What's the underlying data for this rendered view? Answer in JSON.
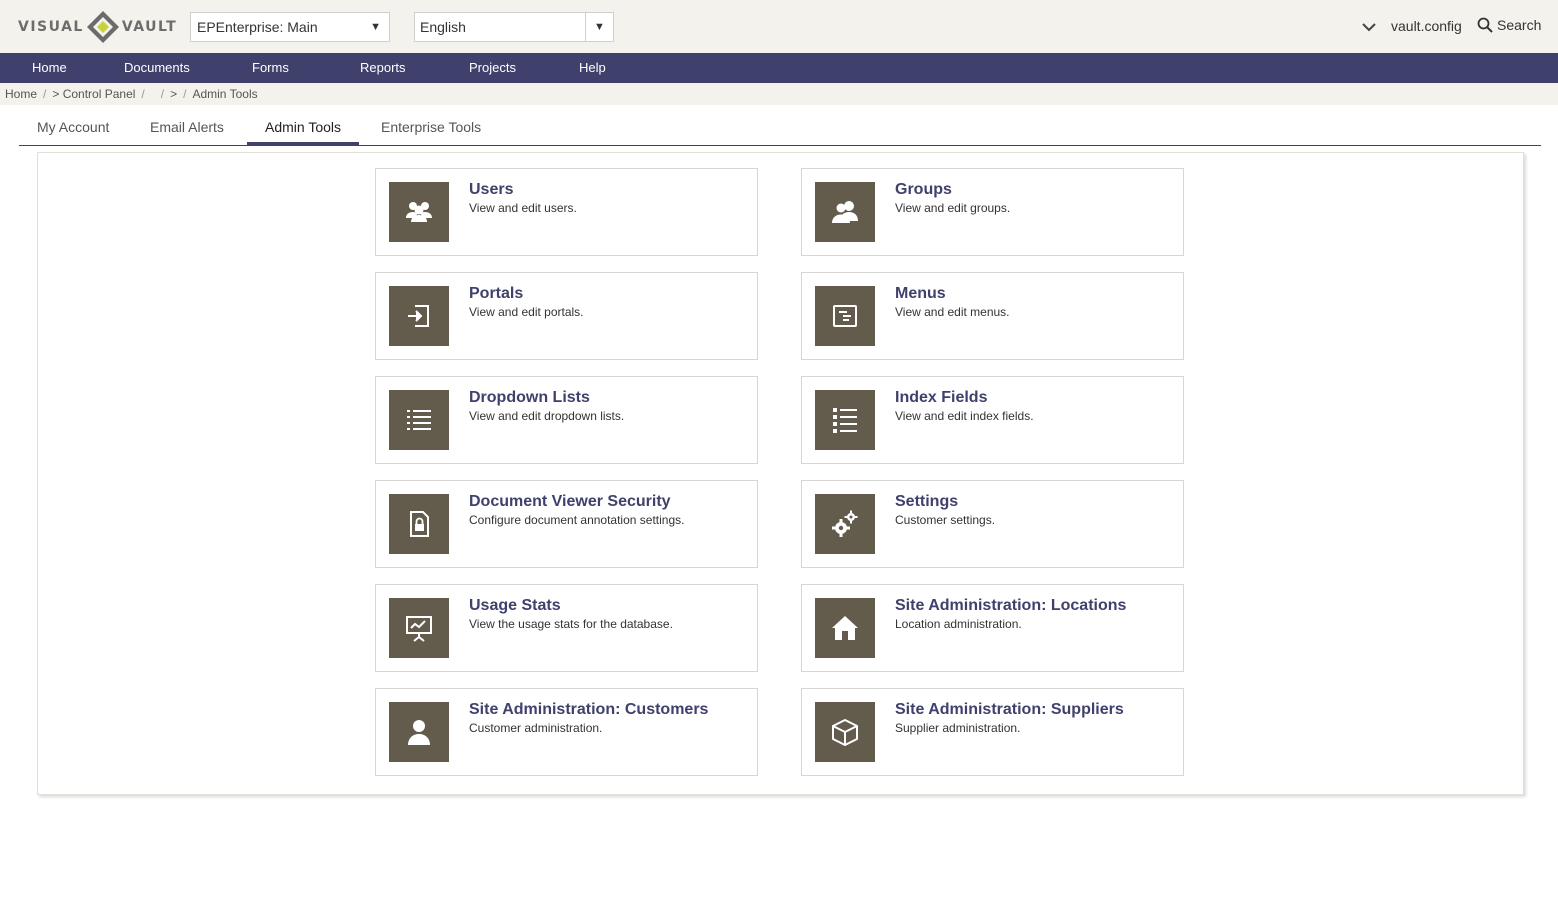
{
  "header": {
    "logo_left": "VISUAL",
    "logo_right": "VAULT",
    "database_select": "EPEnterprise: Main",
    "language_select": "English",
    "user": "vault.config",
    "search_label": "Search"
  },
  "nav": {
    "items": [
      "Home",
      "Documents",
      "Forms",
      "Reports",
      "Projects",
      "Help"
    ]
  },
  "breadcrumb": {
    "home": "Home",
    "control_panel": "> Control Panel",
    "mid": ">",
    "current": "Admin Tools"
  },
  "tabs": [
    "My Account",
    "Email Alerts",
    "Admin Tools",
    "Enterprise Tools"
  ],
  "active_tab": "Admin Tools",
  "cards": [
    {
      "title": "Users",
      "desc": "View and edit users.",
      "icon": "users-icon"
    },
    {
      "title": "Groups",
      "desc": "View and edit groups.",
      "icon": "groups-icon"
    },
    {
      "title": "Portals",
      "desc": "View and edit portals.",
      "icon": "portal-enter-icon"
    },
    {
      "title": "Menus",
      "desc": "View and edit menus.",
      "icon": "menu-icon"
    },
    {
      "title": "Dropdown Lists",
      "desc": "View and edit dropdown lists.",
      "icon": "list-icon"
    },
    {
      "title": "Index Fields",
      "desc": "View and edit index fields.",
      "icon": "index-list-icon"
    },
    {
      "title": "Document Viewer Security",
      "desc": "Configure document annotation settings.",
      "icon": "locked-document-icon"
    },
    {
      "title": "Settings",
      "desc": "Customer settings.",
      "icon": "gears-icon"
    },
    {
      "title": "Usage Stats",
      "desc": "View the usage stats for the database.",
      "icon": "presentation-chart-icon"
    },
    {
      "title": "Site Administration: Locations",
      "desc": "Location administration.",
      "icon": "house-icon"
    },
    {
      "title": "Site Administration: Customers",
      "desc": "Customer administration.",
      "icon": "person-icon"
    },
    {
      "title": "Site Administration: Suppliers",
      "desc": "Supplier administration.",
      "icon": "package-icon"
    }
  ],
  "colors": {
    "nav_bg": "#3f416c",
    "header_bg": "#f4f2ec",
    "icon_box": "#635b4c",
    "card_title": "#3f416c",
    "logo_accent": "#c8d23a"
  }
}
